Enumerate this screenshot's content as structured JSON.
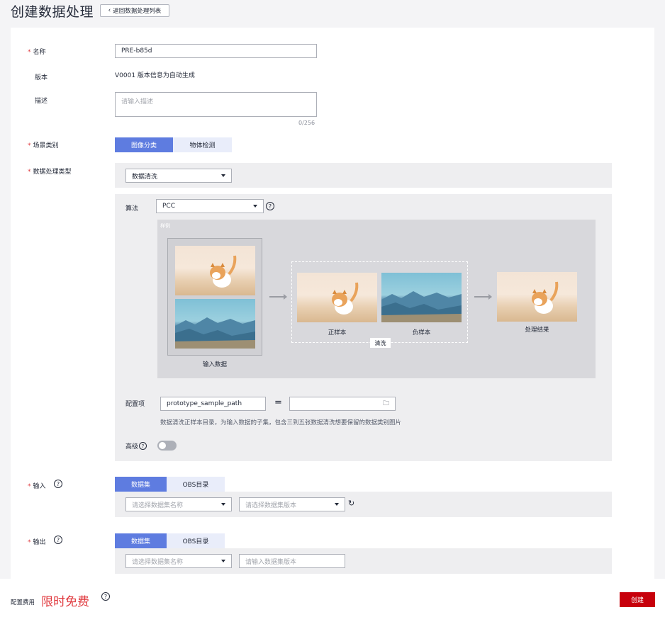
{
  "header": {
    "title": "创建数据处理",
    "back_label": "返回数据处理列表"
  },
  "form": {
    "name": {
      "label": "名称",
      "value": "PRE-b85d"
    },
    "version": {
      "label": "版本",
      "value": "V0001 版本信息为自动生成"
    },
    "description": {
      "label": "描述",
      "placeholder": "请输入描述",
      "counter": "0/256"
    },
    "scene": {
      "label": "场景类别",
      "options": [
        "图像分类",
        "物体检测"
      ],
      "selected": "图像分类"
    },
    "process_type": {
      "label": "数据处理类型",
      "value": "数据清洗"
    },
    "algorithm": {
      "label": "算法",
      "value": "PCC"
    },
    "example": {
      "title": "样例",
      "input_caption": "输入数据",
      "positive_caption": "正样本",
      "negative_caption": "负样本",
      "clean_label": "清洗",
      "result_caption": "处理结果"
    },
    "config": {
      "label": "配置项",
      "key": "prototype_sample_path",
      "equals": "=",
      "value": "",
      "hint": "数据清洗正样本目录，为输入数据的子集，包含三到五张数据清洗想要保留的数据类别图片"
    },
    "advanced": {
      "label": "高级",
      "enabled": false
    },
    "input": {
      "label": "输入",
      "tabs": [
        "数据集",
        "OBS目录"
      ],
      "selected": "数据集",
      "dataset_placeholder": "请选择数据集名称",
      "version_placeholder": "请选择数据集版本"
    },
    "output": {
      "label": "输出",
      "tabs": [
        "数据集",
        "OBS目录"
      ],
      "selected": "数据集",
      "dataset_placeholder": "请选择数据集名称",
      "version_placeholder": "请输入数据集版本"
    }
  },
  "footer": {
    "cost_label": "配置费用",
    "cost_value": "限时免费",
    "create_label": "创建"
  },
  "colors": {
    "primary": "#5e7ce0",
    "danger": "#c7000b",
    "required": "#e0393e"
  }
}
